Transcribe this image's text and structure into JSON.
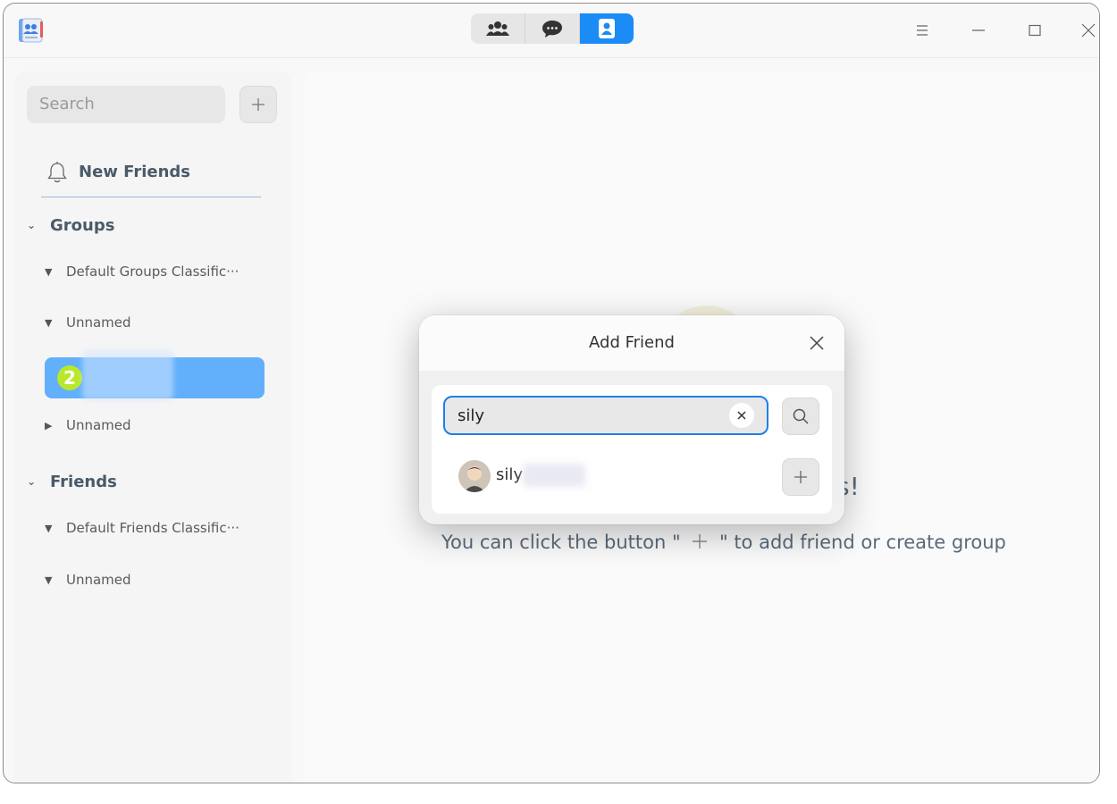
{
  "titlebar": {
    "tabs": [
      {
        "icon": "group-icon",
        "active": false
      },
      {
        "icon": "chat-bubble-icon",
        "active": false
      },
      {
        "icon": "contacts-icon",
        "active": true
      }
    ],
    "controls": [
      "menu-icon",
      "minimize-icon",
      "maximize-icon",
      "close-icon"
    ]
  },
  "sidebar": {
    "search_placeholder": "Search",
    "new_friends_label": "New Friends",
    "groups_label": "Groups",
    "group_items": [
      "Default Groups Classific···",
      "Unnamed",
      "Unnamed"
    ],
    "selected_badge": "2",
    "friends_label": "Friends",
    "friend_items": [
      "Default Friends Classific···",
      "Unnamed"
    ]
  },
  "main": {
    "empty_title_tail": "s!",
    "empty_desc_before": "You can click the button \"",
    "empty_desc_after": "\" to add friend or create group"
  },
  "dialog": {
    "title": "Add Friend",
    "search_value": "sily",
    "result_name": "sily"
  },
  "colors": {
    "accent": "#1b8cf5",
    "selected_row": "#62b0fb",
    "badge": "#b9e82a"
  }
}
